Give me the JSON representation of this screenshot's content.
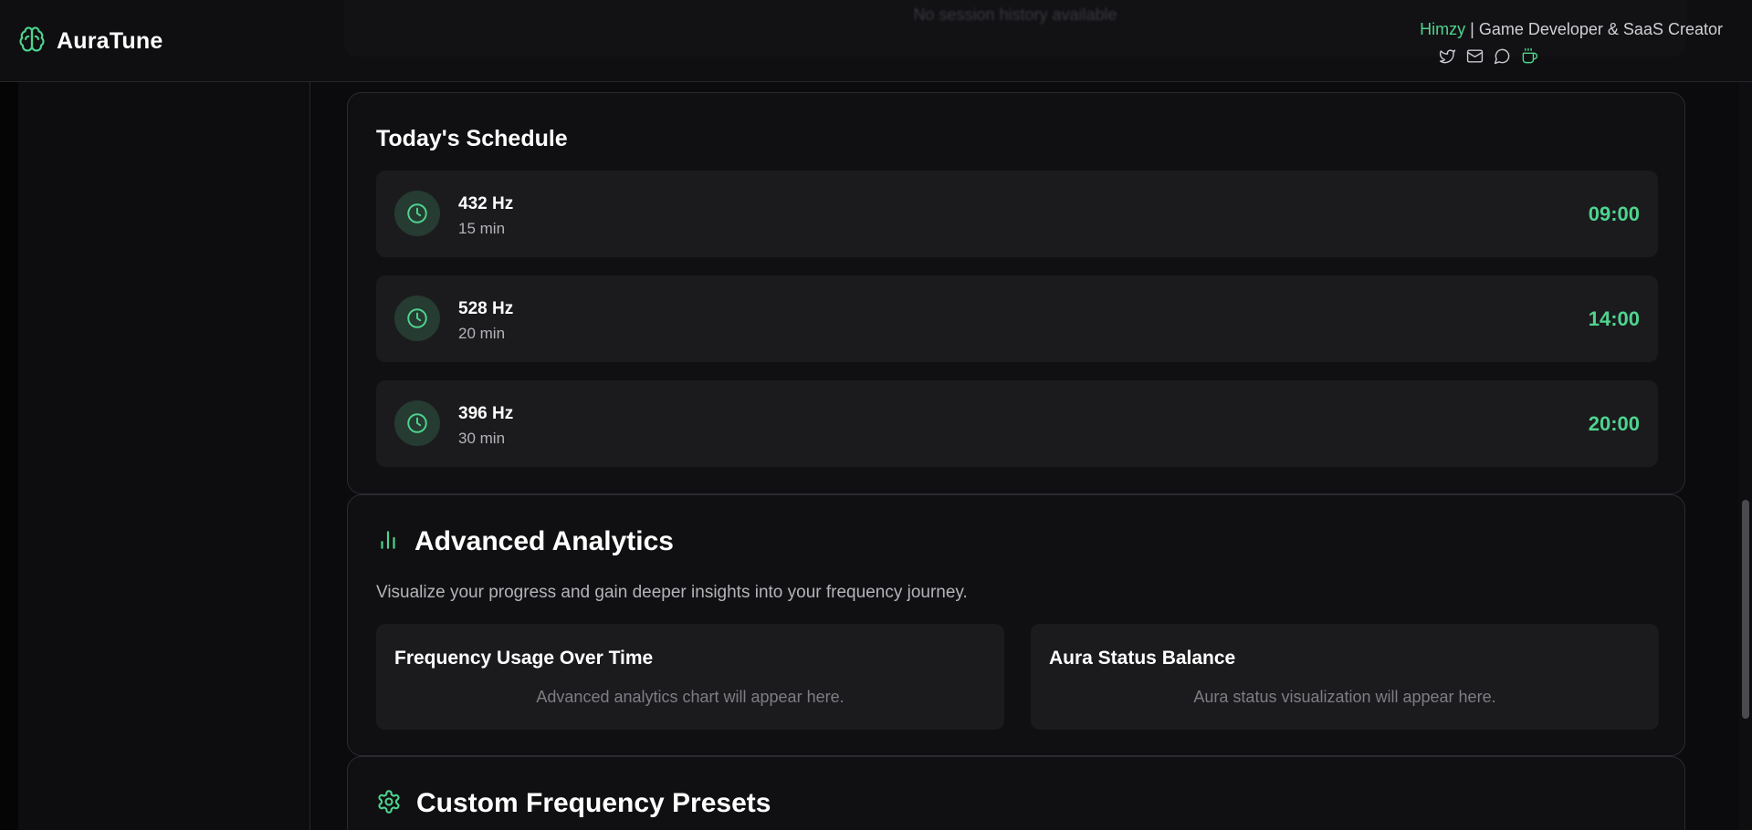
{
  "header": {
    "brand": "AuraTune",
    "faded_text": "No session history available",
    "creator_name": "Himzy",
    "creator_separator": "|",
    "creator_role": "Game Developer & SaaS Creator",
    "social_icons": [
      "twitter-icon",
      "mail-icon",
      "chat-icon",
      "coffee-icon"
    ]
  },
  "schedule": {
    "title": "Today's Schedule",
    "slots": [
      {
        "frequency": "432 Hz",
        "duration": "15 min",
        "time": "09:00"
      },
      {
        "frequency": "528 Hz",
        "duration": "20 min",
        "time": "14:00"
      },
      {
        "frequency": "396 Hz",
        "duration": "30 min",
        "time": "20:00"
      }
    ]
  },
  "analytics": {
    "title": "Advanced Analytics",
    "subtitle": "Visualize your progress and gain deeper insights into your frequency journey.",
    "panels": [
      {
        "title": "Frequency Usage Over Time",
        "note": "Advanced analytics chart will appear here."
      },
      {
        "title": "Aura Status Balance",
        "note": "Aura status visualization will appear here."
      }
    ]
  },
  "presets": {
    "title": "Custom Frequency Presets"
  },
  "colors": {
    "accent": "#4ed48f",
    "background": "#0b0b0d",
    "card": "#101012",
    "slot": "#1b1b1e"
  }
}
